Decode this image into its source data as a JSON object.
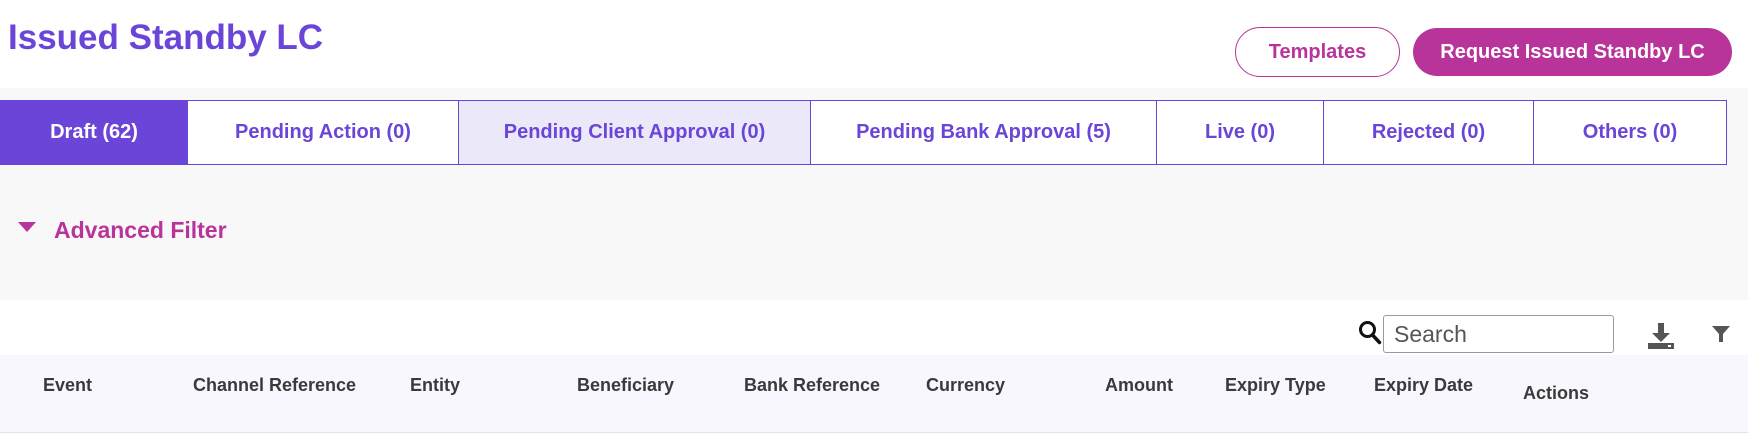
{
  "header": {
    "title": "Issued Standby LC",
    "templates_label": "Templates",
    "request_label": "Request Issued Standby LC"
  },
  "tabs": [
    {
      "label": "Draft (62)",
      "state": "active"
    },
    {
      "label": "Pending Action (0)",
      "state": "normal"
    },
    {
      "label": "Pending Client Approval (0)",
      "state": "hover"
    },
    {
      "label": "Pending Bank Approval (5)",
      "state": "normal"
    },
    {
      "label": "Live (0)",
      "state": "normal"
    },
    {
      "label": "Rejected (0)",
      "state": "normal"
    },
    {
      "label": "Others (0)",
      "state": "normal"
    }
  ],
  "filter": {
    "advanced_label": "Advanced Filter"
  },
  "toolbar": {
    "search_placeholder": "Search",
    "icons": [
      "search-icon",
      "download-icon",
      "filter-icon"
    ]
  },
  "table": {
    "columns": [
      "Event",
      "Channel Reference",
      "Entity",
      "Beneficiary",
      "Bank Reference",
      "Currency",
      "Amount",
      "Expiry Type",
      "Expiry Date",
      "Actions"
    ]
  },
  "colors": {
    "primary": "#6b45d8",
    "accent": "#b8349a",
    "tab_hover": "#ebe8fa"
  }
}
